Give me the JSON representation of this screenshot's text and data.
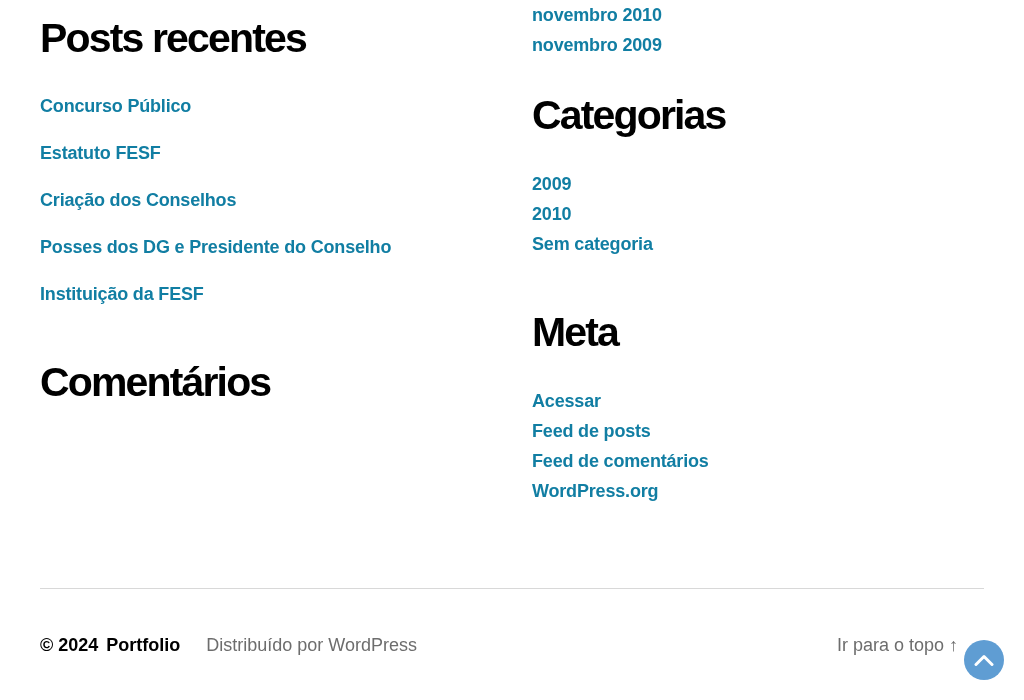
{
  "widget_columns": [
    {
      "widgets": [
        {
          "kind": "posts",
          "title": "Posts recentes",
          "links": [
            "Concurso Público",
            "Estatuto FESF",
            "Criação dos Conselhos",
            "Posses dos DG e Presidente do Conselho",
            "Instituição da FESF"
          ]
        },
        {
          "title": "Comentários"
        }
      ]
    },
    {
      "widgets": [
        {
          "kind": "archives",
          "links": [
            "novembro 2010",
            "novembro 2009"
          ]
        },
        {
          "kind": "categories",
          "title": "Categorias",
          "links": [
            "2009",
            "2010",
            "Sem categoria"
          ]
        },
        {
          "kind": "meta",
          "title": "Meta",
          "links": [
            "Acessar",
            "Feed de posts",
            "Feed de comentários",
            "WordPress.org"
          ]
        }
      ]
    }
  ],
  "footer": {
    "copyright": "© 2024",
    "site_name": "Portfolio",
    "credit": "Distribuído por WordPress",
    "to_top": "Ir para o topo ↑"
  }
}
